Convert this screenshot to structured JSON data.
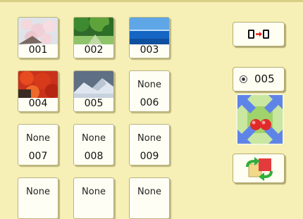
{
  "grid": {
    "slots": [
      {
        "id": "001",
        "label": "",
        "thumb": "blossom"
      },
      {
        "id": "002",
        "label": "",
        "thumb": "forest"
      },
      {
        "id": "003",
        "label": "",
        "thumb": "sea"
      },
      {
        "id": "004",
        "label": "",
        "thumb": "maple"
      },
      {
        "id": "005",
        "label": "",
        "thumb": "mountain"
      },
      {
        "id": "006",
        "label": "None",
        "thumb": ""
      },
      {
        "id": "007",
        "label": "None",
        "thumb": ""
      },
      {
        "id": "008",
        "label": "None",
        "thumb": ""
      },
      {
        "id": "009",
        "label": "None",
        "thumb": ""
      },
      {
        "id": "",
        "label": "None",
        "thumb": ""
      },
      {
        "id": "",
        "label": "None",
        "thumb": ""
      },
      {
        "id": "",
        "label": "None",
        "thumb": ""
      }
    ]
  },
  "right_panel": {
    "copy_icon": "screen-to-screen-icon",
    "selected_label": "005",
    "radio_icon": "radio-dot-icon",
    "move_icon": "expand-arrows-icon",
    "swap_icon": "swap-images-icon"
  },
  "colors": {
    "background": "#f6f0b6",
    "slot_face": "#fffef4"
  }
}
